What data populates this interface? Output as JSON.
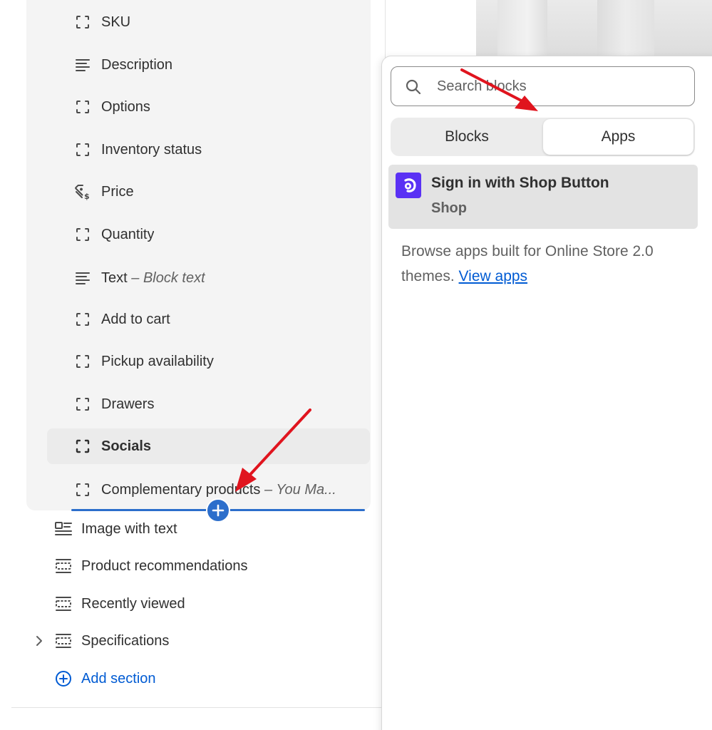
{
  "left_panel": {
    "blocks": [
      {
        "label": "SKU",
        "suffix": "",
        "icon": "block-icon"
      },
      {
        "label": "Description",
        "suffix": "",
        "icon": "text-lines-icon"
      },
      {
        "label": "Options",
        "suffix": "",
        "icon": "block-icon"
      },
      {
        "label": "Inventory status",
        "suffix": "",
        "icon": "block-icon"
      },
      {
        "label": "Price",
        "suffix": "",
        "icon": "price-tag-icon"
      },
      {
        "label": "Quantity",
        "suffix": "",
        "icon": "block-icon"
      },
      {
        "label": "Text",
        "suffix": "Block text",
        "icon": "text-lines-icon"
      },
      {
        "label": "Add to cart",
        "suffix": "",
        "icon": "block-icon"
      },
      {
        "label": "Pickup availability",
        "suffix": "",
        "icon": "block-icon"
      },
      {
        "label": "Drawers",
        "suffix": "",
        "icon": "block-icon"
      },
      {
        "label": "Socials",
        "suffix": "",
        "icon": "block-icon"
      },
      {
        "label": "Complementary products",
        "suffix": "You Ma...",
        "icon": "block-icon"
      }
    ],
    "suffix_separator": " – ",
    "sections": [
      {
        "label": "Image with text",
        "icon": "image-with-text-icon"
      },
      {
        "label": "Product recommendations",
        "icon": "section-icon"
      },
      {
        "label": "Recently viewed",
        "icon": "section-icon"
      },
      {
        "label": "Specifications",
        "icon": "section-icon"
      }
    ],
    "add_section_label": "Add section"
  },
  "popover": {
    "search_placeholder": "Search blocks",
    "tabs": {
      "blocks": "Blocks",
      "apps": "Apps"
    },
    "active_tab": "Apps",
    "app_item": {
      "title": "Sign in with Shop Button",
      "subtitle": "Shop"
    },
    "browse_text": "Browse apps built for Online Store 2.0 themes.",
    "view_apps_link": "View apps"
  },
  "colors": {
    "accent_blue": "#2c6ecb",
    "link_blue": "#005bd3",
    "shop_purple": "#5a31f4",
    "annotation_red": "#e0141e"
  }
}
